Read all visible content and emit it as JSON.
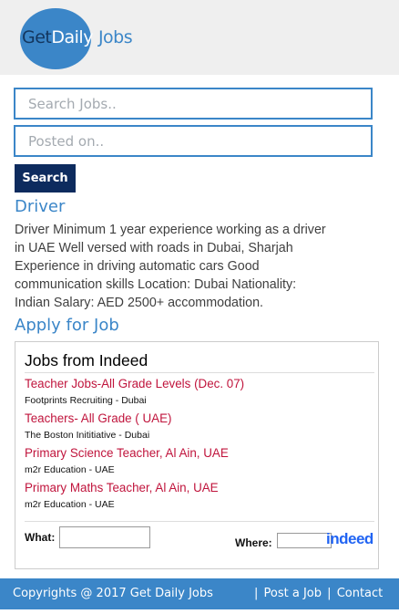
{
  "header": {
    "logo": {
      "get": "Get",
      "daily": "Daily",
      "jobs": "Jobs"
    }
  },
  "search": {
    "keyword_placeholder": "Search Jobs..",
    "date_placeholder": "Posted on..",
    "button_label": "Search"
  },
  "job": {
    "title": "Driver",
    "description": "Driver Minimum 1 year experience working as a driver in UAE Well versed with roads in Dubai, Sharjah Experience in driving automatic cars Good communication skills Location: Dubai Nationality: Indian Salary: AED 2500+ accommodation.",
    "apply_label": "Apply for Job"
  },
  "indeed_widget": {
    "title": "Jobs from Indeed",
    "jobs": [
      {
        "title": "Teacher Jobs-All Grade Levels (Dec. 07)",
        "source": "Footprints Recruiting - Dubai"
      },
      {
        "title": "Teachers- All Grade ( UAE)",
        "source": "The Boston Inititiative - Dubai"
      },
      {
        "title": "Primary Science Teacher, Al Ain, UAE",
        "source": "m2r Education - UAE"
      },
      {
        "title": "Primary Maths Teacher, Al Ain, UAE",
        "source": "m2r Education - UAE"
      }
    ],
    "what_label": "What:",
    "where_label": "Where:",
    "brand": "indeed"
  },
  "footer": {
    "copyright": "Copyrights @ 2017 Get Daily Jobs",
    "separator": "|",
    "post_job": "Post a Job",
    "contact": "Contact"
  },
  "colors": {
    "brand_blue": "#3b86c8",
    "navy": "#0d2b5e",
    "job_link_red": "#c0143c",
    "indeed_blue": "#2164f3"
  }
}
